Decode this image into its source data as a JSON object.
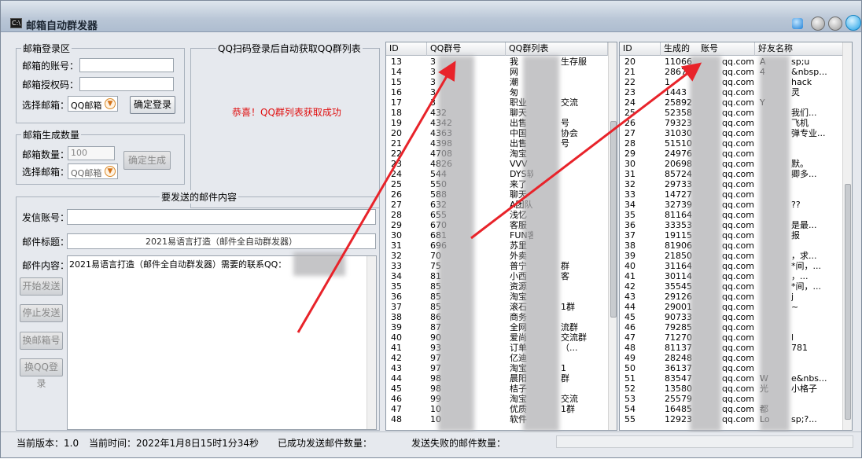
{
  "window": {
    "title": "邮箱自动群发器"
  },
  "login": {
    "legend": "邮箱登录区",
    "account_label": "邮箱的账号：",
    "auth_label": "邮箱授权码：",
    "choose_label": "选择邮箱：",
    "mailbox": "QQ邮箱",
    "login_button": "确定登录"
  },
  "qr": {
    "title": "QQ扫码登录后自动获取QQ群列表",
    "success": "恭喜！QQ群列表获取成功"
  },
  "gen": {
    "legend": "邮箱生成数量",
    "count_label": "邮箱数量：",
    "count_value": "100",
    "choose_label": "选择邮箱：",
    "mailbox": "QQ邮箱",
    "button": "确定生成"
  },
  "mail": {
    "legend": "要发送的邮件内容",
    "sender_label": "发信账号：",
    "subject_label": "邮件标题：",
    "subject_value": "2021易语言打造（邮件全自动群发器）",
    "body_label": "邮件内容：",
    "body_value": "2021易语言打造（邮件全自动群发器）需要的联系QQ：",
    "buttons": [
      "开始发送",
      "停止发送",
      "换邮箱号",
      "换QQ登录"
    ]
  },
  "groups": {
    "headers": [
      "ID",
      "QQ群号",
      "QQ群列表"
    ],
    "rows": [
      [
        "13",
        "3",
        "我",
        "生存服"
      ],
      [
        "14",
        "3",
        "网",
        ""
      ],
      [
        "15",
        "3",
        "潮",
        ""
      ],
      [
        "16",
        "3",
        "匆",
        ""
      ],
      [
        "17",
        "3",
        "职业",
        "交流"
      ],
      [
        "18",
        "432",
        "聊天",
        ""
      ],
      [
        "19",
        "4342",
        "出售",
        "号"
      ],
      [
        "20",
        "4363",
        "中国",
        "协会"
      ],
      [
        "21",
        "4398",
        "出售",
        "号"
      ],
      [
        "22",
        "4708",
        "淘宝",
        ""
      ],
      [
        "23",
        "4826",
        "VVV",
        ""
      ],
      [
        "24",
        "544",
        "DYS软",
        ""
      ],
      [
        "25",
        "550",
        "来了",
        ""
      ],
      [
        "26",
        "588",
        "聊天",
        ""
      ],
      [
        "27",
        "632",
        "A团队",
        ""
      ],
      [
        "28",
        "655",
        "浅忆",
        ""
      ],
      [
        "29",
        "670",
        "客服",
        ""
      ],
      [
        "30",
        "681",
        "FUN客",
        ""
      ],
      [
        "31",
        "696",
        "苏里",
        ""
      ],
      [
        "32",
        "70",
        "外卖",
        ""
      ],
      [
        "33",
        "75",
        "普宁",
        "群"
      ],
      [
        "34",
        "81",
        "小西",
        "客"
      ],
      [
        "35",
        "85",
        "资源",
        ""
      ],
      [
        "36",
        "85",
        "淘宝",
        ""
      ],
      [
        "37",
        "85",
        "滚石",
        "1群"
      ],
      [
        "38",
        "86",
        "商务",
        ""
      ],
      [
        "39",
        "87",
        "全网",
        "流群"
      ],
      [
        "40",
        "90",
        "爱尚",
        "交流群"
      ],
      [
        "41",
        "93",
        "订单",
        "（..."
      ],
      [
        "42",
        "97",
        "亿迪",
        ""
      ],
      [
        "43",
        "97",
        "淘宝",
        "1"
      ],
      [
        "44",
        "98",
        "晨阳",
        "群"
      ],
      [
        "45",
        "98",
        "桔子",
        ""
      ],
      [
        "46",
        "99",
        "淘宝",
        "交流"
      ],
      [
        "47",
        "10",
        "优质",
        "1群"
      ],
      [
        "48",
        "10",
        "软件",
        ""
      ]
    ]
  },
  "emails": {
    "headers": [
      "ID",
      "生成的",
      "账号",
      "好友名称"
    ],
    "rows": [
      [
        "20",
        "11066",
        "qq.com",
        "A",
        "sp;u"
      ],
      [
        "21",
        "2867",
        "qq.com",
        "4",
        "&nbsp..."
      ],
      [
        "22",
        "1",
        "qq.com",
        "",
        "hack"
      ],
      [
        "23",
        "1443",
        "qq.com",
        "",
        "灵"
      ],
      [
        "24",
        "25892",
        "qq.com",
        "Y",
        ""
      ],
      [
        "25",
        "52358",
        "qq.com",
        "",
        "我们..."
      ],
      [
        "26",
        "79323",
        "qq.com",
        "",
        "飞机"
      ],
      [
        "27",
        "31030",
        "qq.com",
        "",
        "弹专业..."
      ],
      [
        "28",
        "51510",
        "qq.com",
        "",
        ""
      ],
      [
        "29",
        "24976",
        "qq.com",
        "",
        ""
      ],
      [
        "30",
        "20698",
        "qq.com",
        "",
        "默。"
      ],
      [
        "31",
        "85724",
        "qq.com",
        "",
        "卿多..."
      ],
      [
        "32",
        "29733",
        "qq.com",
        "",
        ""
      ],
      [
        "33",
        "14727",
        "qq.com",
        "",
        ""
      ],
      [
        "34",
        "32739",
        "qq.com",
        "",
        "??"
      ],
      [
        "35",
        "81164",
        "qq.com",
        "",
        ""
      ],
      [
        "36",
        "33353",
        "qq.com",
        "",
        "是最..."
      ],
      [
        "37",
        "19115",
        "qq.com",
        "",
        "报"
      ],
      [
        "38",
        "81906",
        "qq.com",
        "",
        ""
      ],
      [
        "39",
        "21850",
        "qq.com",
        "",
        "，求..."
      ],
      [
        "40",
        "31164",
        "qq.com",
        "",
        "*间，..."
      ],
      [
        "41",
        "30114",
        "qq.com",
        "",
        "，..."
      ],
      [
        "42",
        "35545",
        "qq.com",
        "",
        "*间，..."
      ],
      [
        "43",
        "29126",
        "qq.com",
        "",
        "j"
      ],
      [
        "44",
        "29001",
        "qq.com",
        "",
        "~"
      ],
      [
        "45",
        "90733",
        "qq.com",
        "",
        ""
      ],
      [
        "46",
        "79285",
        "qq.com",
        "",
        ""
      ],
      [
        "47",
        "71270",
        "qq.com",
        "",
        "l"
      ],
      [
        "48",
        "81137",
        "qq.com",
        "",
        "781"
      ],
      [
        "49",
        "28248",
        "qq.com",
        "",
        ""
      ],
      [
        "50",
        "36137",
        "qq.com",
        "",
        ""
      ],
      [
        "51",
        "83547",
        "qq.com",
        "W",
        "e&nbs..."
      ],
      [
        "52",
        "13580",
        "qq.com",
        "光",
        "小格子"
      ],
      [
        "53",
        "25579",
        "qq.com",
        "",
        ""
      ],
      [
        "54",
        "16485",
        "qq.com",
        "都",
        ""
      ],
      [
        "55",
        "12923",
        "qq.com",
        "Lo",
        "sp;?..."
      ]
    ]
  },
  "status": {
    "version": "当前版本：1.0",
    "time": "当前时间：2022年1月8日15时1分34秒",
    "sent": "已成功发送邮件数量：",
    "failed": "发送失败的邮件数量："
  },
  "colors": {
    "success_text": "#e01010",
    "annotation_arrow": "#e8232a"
  }
}
